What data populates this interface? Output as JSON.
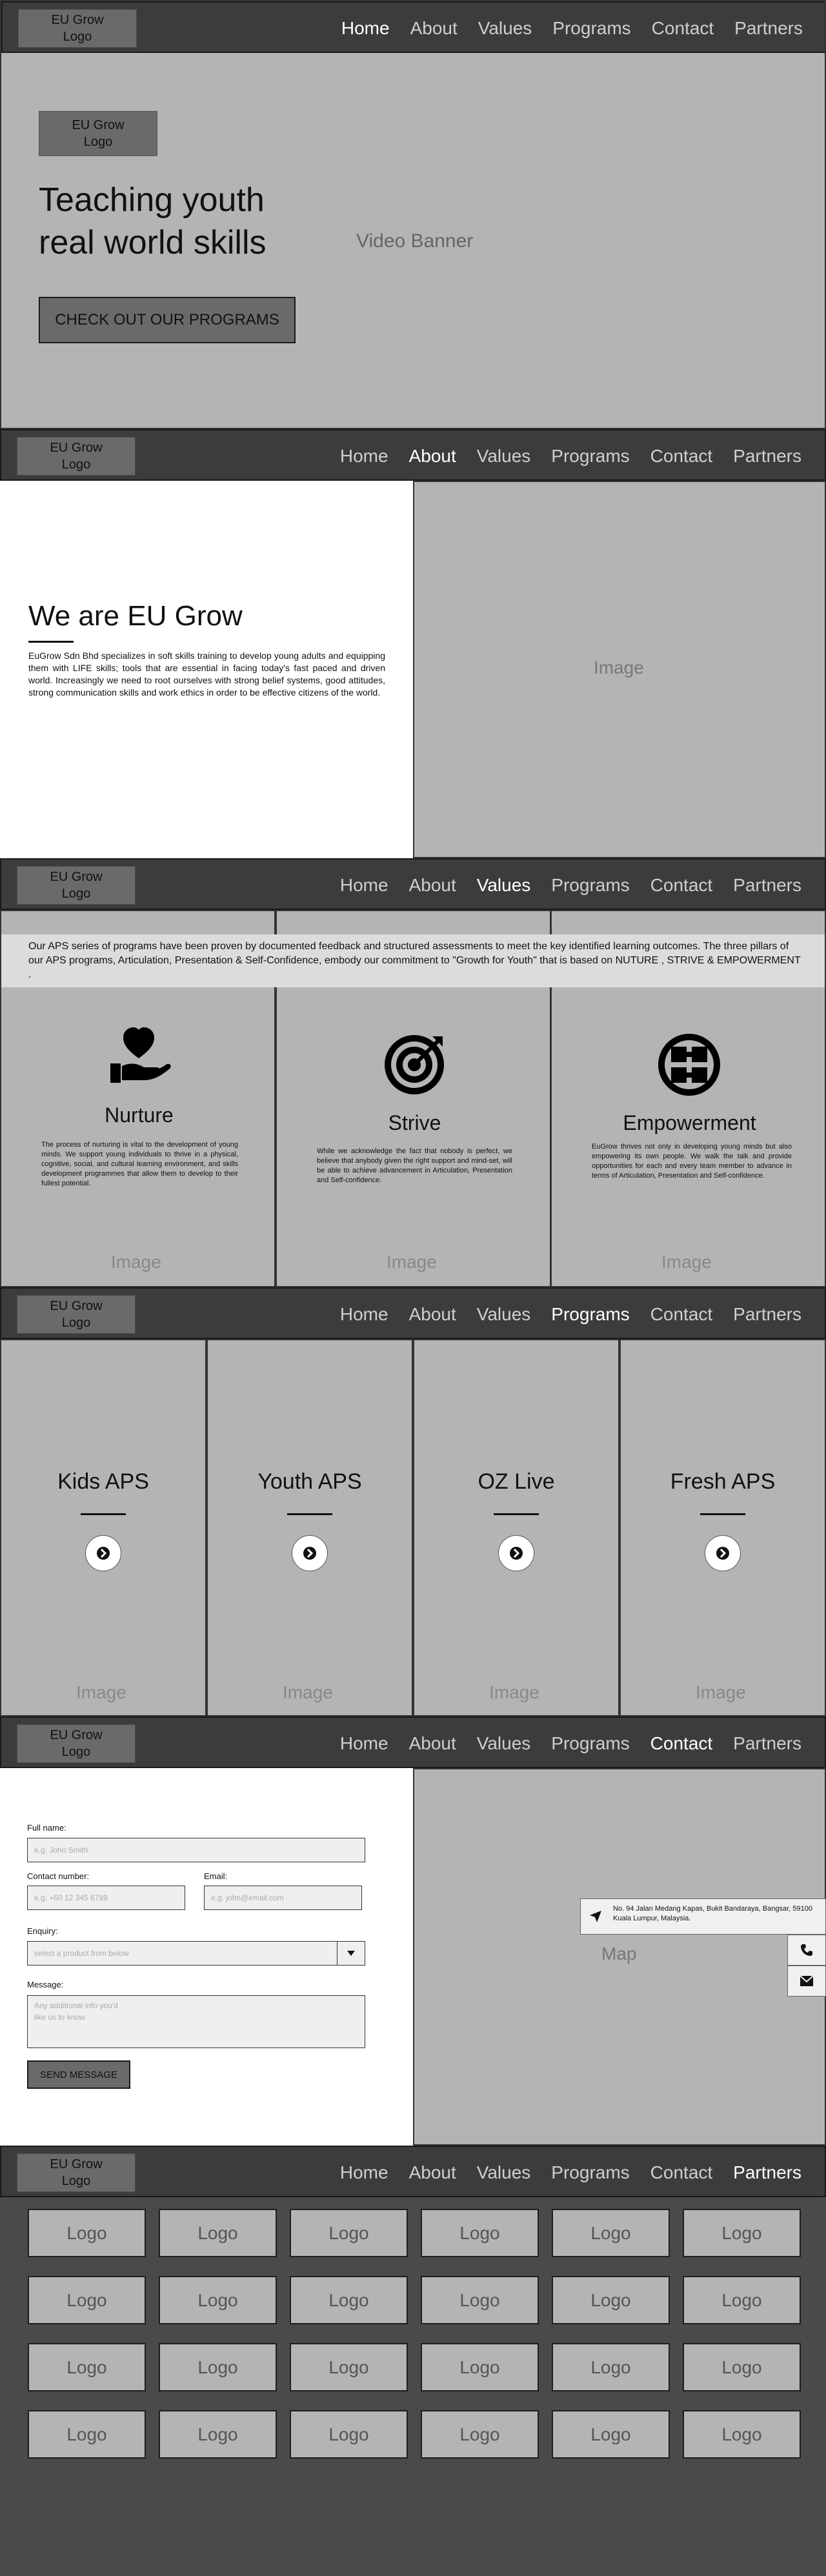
{
  "nav": {
    "logo": "EU Grow\nLogo",
    "links": [
      "Home",
      "About",
      "Values",
      "Programs",
      "Contact",
      "Partners"
    ]
  },
  "hero": {
    "logo": "EU Grow\nLogo",
    "headline_line1": "Teaching youth",
    "headline_line2": "real world skills",
    "cta": "CHECK OUT OUR PROGRAMS",
    "banner": "Video Banner"
  },
  "about": {
    "title": "We are EU Grow",
    "body": "EuGrow Sdn Bhd specializes in soft skills training to develop young adults and equipping them with LIFE skills; tools that are essential in facing today's fast paced and driven world. Increasingly we need to root ourselves with strong belief systems, good attitudes, strong communication skills and work ethics in order to be effective citizens of the world.",
    "image": "Image"
  },
  "values": {
    "intro": "Our APS series of programs have been proven by documented feedback and structured assessments to meet the key identified learning outcomes. The three pillars of our APS programs, Articulation, Presentation & Self-Confidence, embody our commitment to \"Growth for Youth\" that is based on NUTURE , STRIVE  & EMPOWERMENT .",
    "columns": [
      {
        "title": "Nurture",
        "body": "The process of nurturing is vital to the development of young minds. We support young individuals to thrive in a physical, cognitive, social, and cultural learning environment, and skills development programmes that allow them to develop to their fullest potential.",
        "image": "Image",
        "icon": "heart-hand-icon"
      },
      {
        "title": "Strive",
        "body": "While we acknowledge the fact that nobody is perfect, we believe that anybody given the right support and mind-set, will be able to achieve advancement in Articulation, Presentation and Self-confidence.",
        "image": "Image",
        "icon": "target-icon"
      },
      {
        "title": "Empowerment",
        "body": "EuGrow thrives not only in developing young minds but also empowering its own people. We walk the talk and provide opportunities for each and every team member to advance in terms of Articulation, Presentation and Self-confidence.",
        "image": "Image",
        "icon": "hands-circle-icon"
      }
    ]
  },
  "programs": {
    "items": [
      {
        "title": "Kids APS",
        "image": "Image"
      },
      {
        "title": "Youth APS",
        "image": "Image"
      },
      {
        "title": "OZ Live",
        "image": "Image"
      },
      {
        "title": "Fresh APS",
        "image": "Image"
      }
    ]
  },
  "contact": {
    "fullname_label": "Full name:",
    "fullname_placeholder": "e.g. John Smith",
    "phone_label": "Contact number:",
    "phone_placeholder": "e.g. +60 12 345 6789",
    "email_label": "Email:",
    "email_placeholder": "e.g. john@email.com",
    "enquiry_label": "Enquiry:",
    "enquiry_placeholder": "select a product from below",
    "message_label": "Message:",
    "message_placeholder": "Any additional info you'd like us to know",
    "send": "SEND MESSAGE",
    "map": "Map",
    "address": "No. 94 Jalan Medang Kapas, Bukit Bandaraya, Bangsar, 59100 Kuala Lumpur, Malaysia."
  },
  "partners": {
    "logos": [
      "Logo",
      "Logo",
      "Logo",
      "Logo",
      "Logo",
      "Logo",
      "Logo",
      "Logo",
      "Logo",
      "Logo",
      "Logo",
      "Logo",
      "Logo",
      "Logo",
      "Logo",
      "Logo",
      "Logo",
      "Logo",
      "Logo",
      "Logo",
      "Logo",
      "Logo",
      "Logo",
      "Logo"
    ]
  },
  "colors": {
    "nav_bg": "#3c3c3c",
    "panel_grey": "#b4b4b4",
    "partners_bg": "#4a4a4a"
  }
}
